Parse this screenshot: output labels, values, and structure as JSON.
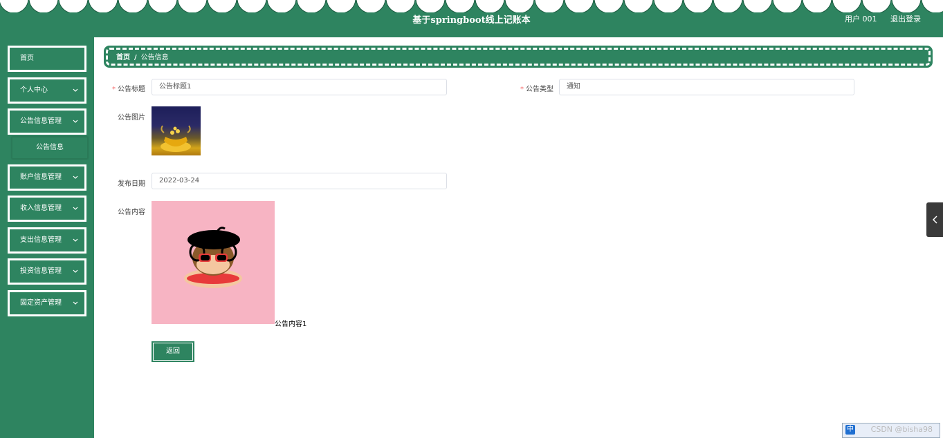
{
  "header": {
    "title": "基于springboot线上记账本",
    "user_label": "用户 001",
    "logout_label": "退出登录"
  },
  "sidebar": {
    "items": [
      {
        "label": "首页"
      },
      {
        "label": "个人中心"
      },
      {
        "label": "公告信息管理"
      },
      {
        "label": "公告信息"
      },
      {
        "label": "账户信息管理"
      },
      {
        "label": "收入信息管理"
      },
      {
        "label": "支出信息管理"
      },
      {
        "label": "投资信息管理"
      },
      {
        "label": "固定资产管理"
      }
    ]
  },
  "breadcrumb": {
    "home": "首页",
    "separator": "/",
    "current": "公告信息"
  },
  "form": {
    "title_label": "公告标题",
    "title_value": "公告标题1",
    "type_label": "公告类型",
    "type_value": "通知",
    "image_label": "公告图片",
    "date_label": "发布日期",
    "date_value": "2022-03-24",
    "content_label": "公告内容",
    "content_text": "公告内容1",
    "back_button": "返回"
  },
  "watermark": "CSDN @bisha98",
  "tray_icon": "中",
  "colors": {
    "brand": "#2e8460",
    "required": "#f56c6c"
  }
}
